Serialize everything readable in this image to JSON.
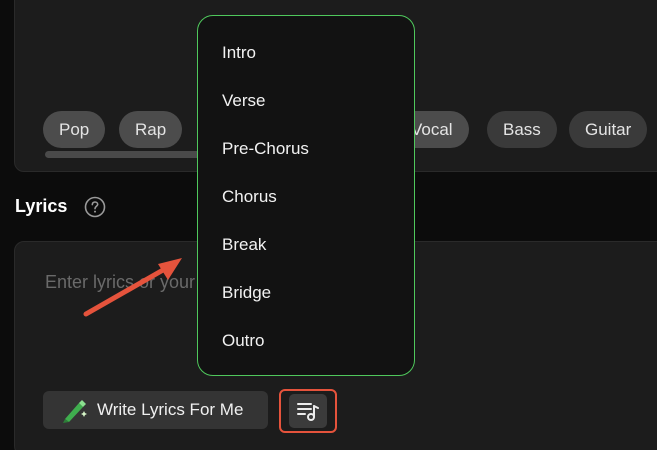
{
  "style_tags": [
    "Pop",
    "Rap",
    "Vocal",
    "Bass",
    "Guitar"
  ],
  "lyrics": {
    "title": "Lyrics",
    "placeholder": "Enter lyrics or your own words to get inspired",
    "write_button_label": "Write Lyrics For Me"
  },
  "section_menu": {
    "items": [
      "Intro",
      "Verse",
      "Pre-Chorus",
      "Chorus",
      "Break",
      "Bridge",
      "Outro"
    ]
  },
  "colors": {
    "menu_border": "#4fc85c",
    "highlight_box": "#e5533c",
    "arrow": "#e5533c"
  },
  "icons": {
    "help": "question-circle-icon",
    "write": "magic-pen-icon",
    "section": "music-list-icon"
  }
}
